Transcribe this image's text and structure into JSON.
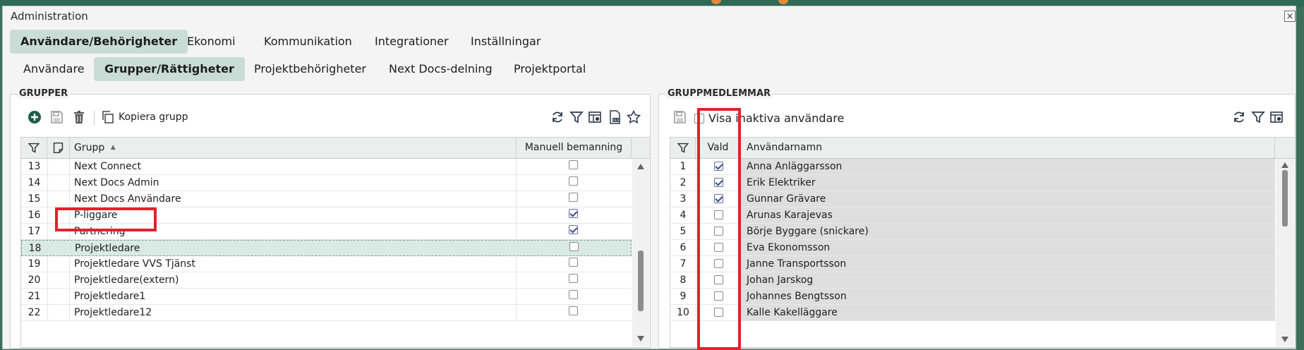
{
  "window": {
    "title": "Administration",
    "close_glyph": "×"
  },
  "main_tabs": [
    {
      "label": "Användare/Behörigheter",
      "active": true
    },
    {
      "label": "Ekonomi",
      "active": false
    },
    {
      "label": "Kommunikation",
      "active": false
    },
    {
      "label": "Integrationer",
      "active": false
    },
    {
      "label": "Inställningar",
      "active": false
    }
  ],
  "sub_tabs": [
    {
      "label": "Användare",
      "active": false
    },
    {
      "label": "Grupper/Rättigheter",
      "active": true
    },
    {
      "label": "Projektbehörigheter",
      "active": false
    },
    {
      "label": "Next Docs-delning",
      "active": false
    },
    {
      "label": "Projektportal",
      "active": false
    }
  ],
  "groups": {
    "title": "GRUPPER",
    "copy_label": "Kopiera grupp",
    "columns": {
      "group": "Grupp",
      "sort_glyph": "▲",
      "manual": "Manuell bemanning"
    },
    "rows": [
      {
        "nr": "13",
        "name": "Next Connect",
        "manual": false
      },
      {
        "nr": "14",
        "name": "Next Docs Admin",
        "manual": false
      },
      {
        "nr": "15",
        "name": "Next Docs Användare",
        "manual": false
      },
      {
        "nr": "16",
        "name": "P-liggare",
        "manual": true
      },
      {
        "nr": "17",
        "name": "Partnering",
        "manual": true
      },
      {
        "nr": "18",
        "name": "Projektledare",
        "manual": false,
        "selected": true
      },
      {
        "nr": "19",
        "name": "Projektledare VVS Tjänst",
        "manual": false
      },
      {
        "nr": "20",
        "name": "Projektledare(extern)",
        "manual": false
      },
      {
        "nr": "21",
        "name": "Projektledare1",
        "manual": false
      },
      {
        "nr": "22",
        "name": "Projektledare12",
        "manual": false
      }
    ]
  },
  "members": {
    "title": "GRUPPMEDLEMMAR",
    "show_inactive_label": "Visa inaktiva användare",
    "columns": {
      "selected": "Vald",
      "username": "Användarnamn"
    },
    "rows": [
      {
        "nr": "1",
        "name": "Anna Anläggarsson",
        "selected": true
      },
      {
        "nr": "2",
        "name": "Erik Elektriker",
        "selected": true
      },
      {
        "nr": "3",
        "name": "Gunnar Grävare",
        "selected": true
      },
      {
        "nr": "4",
        "name": "Arunas Karajevas",
        "selected": false
      },
      {
        "nr": "5",
        "name": "Börje Byggare (snickare)",
        "selected": false
      },
      {
        "nr": "6",
        "name": "Eva Ekonomsson",
        "selected": false
      },
      {
        "nr": "7",
        "name": "Janne Transportsson",
        "selected": false
      },
      {
        "nr": "8",
        "name": "Johan Jarskog",
        "selected": false
      },
      {
        "nr": "9",
        "name": "Johannes Bengtsson",
        "selected": false
      },
      {
        "nr": "10",
        "name": "Kalle Kakelläggare",
        "selected": false
      }
    ]
  },
  "colors": {
    "accent": "#c9ddd6",
    "highlight": "#e0222c",
    "check": "#3c4b9c"
  }
}
